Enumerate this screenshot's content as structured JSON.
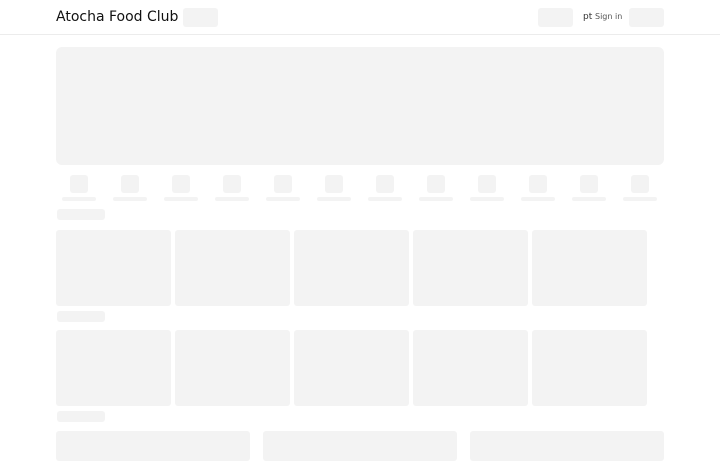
{
  "header": {
    "brand": "Atocha Food Club",
    "language": "pt",
    "sign_in": "Sign in"
  },
  "colors": {
    "skeleton": "#f3f3f3",
    "divider": "#ececec",
    "text": "#111111"
  },
  "categories_count": 12,
  "rails": [
    {
      "cards": 5
    },
    {
      "cards": 5
    }
  ]
}
